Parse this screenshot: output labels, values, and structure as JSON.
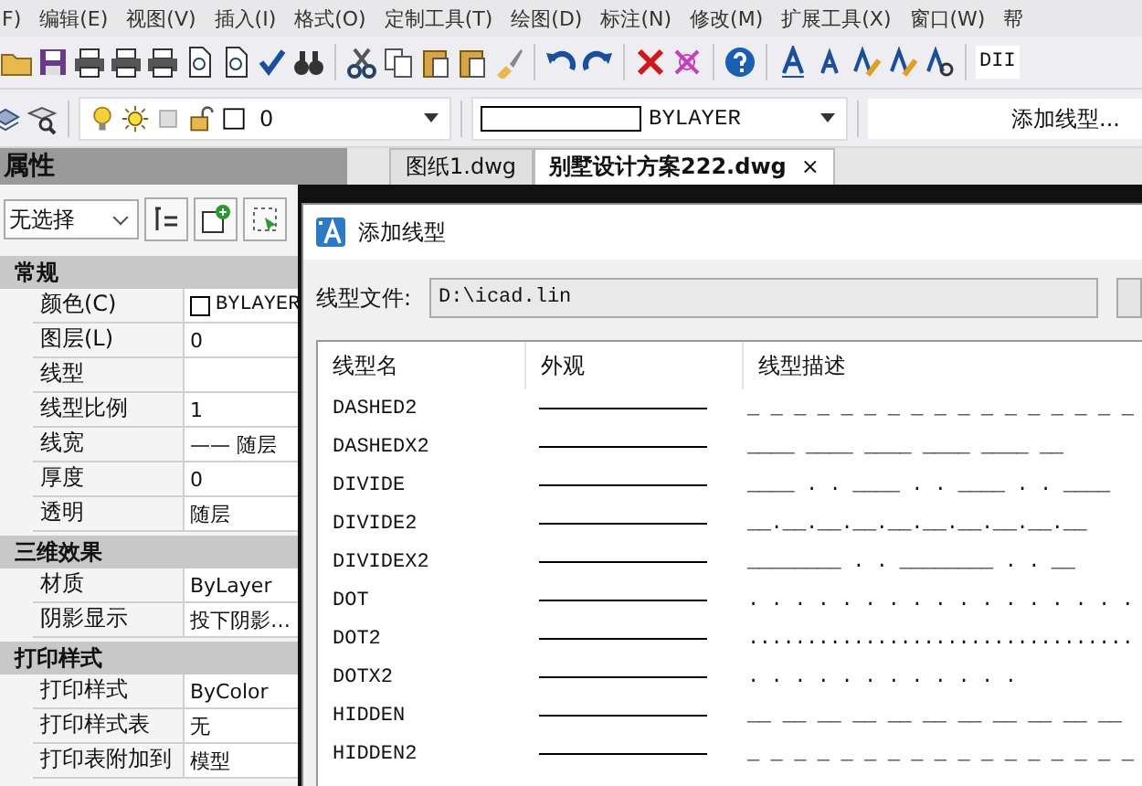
{
  "menu": [
    "F)",
    "编辑(E)",
    "视图(V)",
    "插入(I)",
    "格式(O)",
    "定制工具(T)",
    "绘图(D)",
    "标注(N)",
    "修改(M)",
    "扩展工具(X)",
    "窗口(W)",
    "帮"
  ],
  "style_box": {
    "value": "DII"
  },
  "layer_control": {
    "value": "0"
  },
  "linetype_control": {
    "value": "BYLAYER"
  },
  "linetype_field": {
    "value": "添加线型..."
  },
  "properties": {
    "title": "属性",
    "selection": "无选择",
    "sections": [
      {
        "title": "常规",
        "rows": [
          {
            "label": "颜色(C)",
            "value": "BYLAYER",
            "kind": "color"
          },
          {
            "label": "图层(L)",
            "value": "0",
            "kind": "text"
          },
          {
            "label": "线型",
            "kind": "text"
          },
          {
            "label": "线型比例",
            "value": "1",
            "kind": "text"
          },
          {
            "label": "线宽",
            "value": "—— 随层",
            "kind": "text"
          },
          {
            "label": "厚度",
            "value": "0",
            "kind": "text"
          },
          {
            "label": "透明",
            "value": "随层",
            "kind": "text"
          }
        ]
      },
      {
        "title": "三维效果",
        "rows": [
          {
            "label": "材质",
            "value": "ByLayer",
            "kind": "text"
          },
          {
            "label": "阴影显示",
            "value": "投下阴影…",
            "kind": "text"
          }
        ]
      },
      {
        "title": "打印样式",
        "rows": [
          {
            "label": "打印样式",
            "value": "ByColor",
            "kind": "text"
          },
          {
            "label": "打印样式表",
            "value": "无",
            "kind": "text"
          },
          {
            "label": "打印表附加到",
            "value": "模型",
            "kind": "text"
          }
        ]
      }
    ]
  },
  "tabs": [
    {
      "label": "图纸1.dwg",
      "selected": false
    },
    {
      "label": "别墅设计方案222.dwg",
      "selected": true,
      "close": "×"
    }
  ],
  "dialog": {
    "title": "添加线型",
    "file_label": "线型文件:",
    "file_value": "D:\\icad.lin",
    "columns": [
      "线型名",
      "外观",
      "线型描述"
    ],
    "rows": [
      {
        "name": "DASHED2",
        "description": "_ _ _ _ _ _ _ _ _ _ _ _ _ _ _ _ _"
      },
      {
        "name": "DASHEDX2",
        "description": "____  ____  ____  ____  ____  __"
      },
      {
        "name": "DIVIDE",
        "description": "____ . . ____ . . ____ . . ____"
      },
      {
        "name": "DIVIDE2",
        "description": "__.__.__.__.__.__.__.__.__.__"
      },
      {
        "name": "DIVIDEX2",
        "description": "________  .  .  ________  .  .  __"
      },
      {
        "name": "DOT",
        "description": ". . . . . . . . . . . . . . . . ."
      },
      {
        "name": "DOT2",
        "description": "................................."
      },
      {
        "name": "DOTX2",
        "description": ".  .  .  .  .  .  .  .  .  .  .  ."
      },
      {
        "name": "HIDDEN",
        "description": "__ __ __ __ __ __ __ __ __ __ __"
      },
      {
        "name": "HIDDEN2",
        "description": "_ _ _ _ _ _ _ _ _ _ _ _ _ _ _ _ _"
      }
    ]
  }
}
